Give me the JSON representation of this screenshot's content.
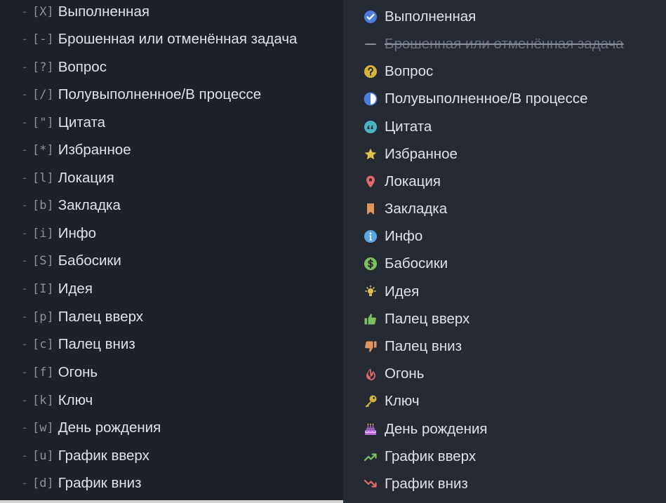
{
  "colors": {
    "left_bg": "#1e2128",
    "right_bg": "#262a33",
    "text": "#dfe2e7",
    "marker": "#8a909c",
    "dash": "#5d6370"
  },
  "source_items": [
    {
      "marker": "[X]",
      "label": "Выполненная"
    },
    {
      "marker": "[-]",
      "label": "Брошенная или отменённая задача"
    },
    {
      "marker": "[?]",
      "label": "Вопрос"
    },
    {
      "marker": "[/]",
      "label": "Полувыполненное/В процессе"
    },
    {
      "marker": "[\"]",
      "label": "Цитата"
    },
    {
      "marker": "[*]",
      "label": "Избранное"
    },
    {
      "marker": "[l]",
      "label": "Локация"
    },
    {
      "marker": "[b]",
      "label": "Закладка"
    },
    {
      "marker": "[i]",
      "label": "Инфо"
    },
    {
      "marker": "[S]",
      "label": "Бабосики"
    },
    {
      "marker": "[I]",
      "label": "Идея"
    },
    {
      "marker": "[p]",
      "label": "Палец вверх"
    },
    {
      "marker": "[c]",
      "label": "Палец вниз"
    },
    {
      "marker": "[f]",
      "label": "Огонь"
    },
    {
      "marker": "[k]",
      "label": "Ключ"
    },
    {
      "marker": "[w]",
      "label": "День рождения"
    },
    {
      "marker": "[u]",
      "label": "График вверх"
    },
    {
      "marker": "[d]",
      "label": "График вниз"
    }
  ],
  "source_dash": "-",
  "rendered_items": [
    {
      "icon": "check-circle-icon",
      "color": "#4a7ddc",
      "label": "Выполненная"
    },
    {
      "icon": "dash-icon",
      "color": "#8a909c",
      "label": "Брошенная или отменённая задача",
      "struck": true
    },
    {
      "icon": "question-circle-icon",
      "color": "#d7b53c",
      "label": "Вопрос"
    },
    {
      "icon": "half-circle-icon",
      "color": "#4a7ddc",
      "label": "Полувыполненное/В процессе"
    },
    {
      "icon": "quote-icon",
      "color": "#4bb4c2",
      "label": "Цитата"
    },
    {
      "icon": "star-icon",
      "color": "#e0bf53",
      "label": "Избранное"
    },
    {
      "icon": "location-pin-icon",
      "color": "#e26868",
      "label": "Локация"
    },
    {
      "icon": "bookmark-icon",
      "color": "#e0955c",
      "label": "Закладка"
    },
    {
      "icon": "info-circle-icon",
      "color": "#59a6e6",
      "label": "Инфо"
    },
    {
      "icon": "dollar-circle-icon",
      "color": "#7fbf5f",
      "label": "Бабосики"
    },
    {
      "icon": "lightbulb-icon",
      "color": "#e0bf53",
      "label": "Идея"
    },
    {
      "icon": "thumbs-up-icon",
      "color": "#7fbf5f",
      "label": "Палец вверх"
    },
    {
      "icon": "thumbs-down-icon",
      "color": "#e0955c",
      "label": "Палец вниз"
    },
    {
      "icon": "fire-icon",
      "color": "#e26868",
      "label": "Огонь"
    },
    {
      "icon": "key-icon",
      "color": "#d7b53c",
      "label": "Ключ"
    },
    {
      "icon": "birthday-cake-icon",
      "color": "#b86bd6",
      "label": "День рождения"
    },
    {
      "icon": "chart-up-icon",
      "color": "#7fbf5f",
      "label": "График вверх"
    },
    {
      "icon": "chart-down-icon",
      "color": "#e26868",
      "label": "График вниз"
    }
  ]
}
